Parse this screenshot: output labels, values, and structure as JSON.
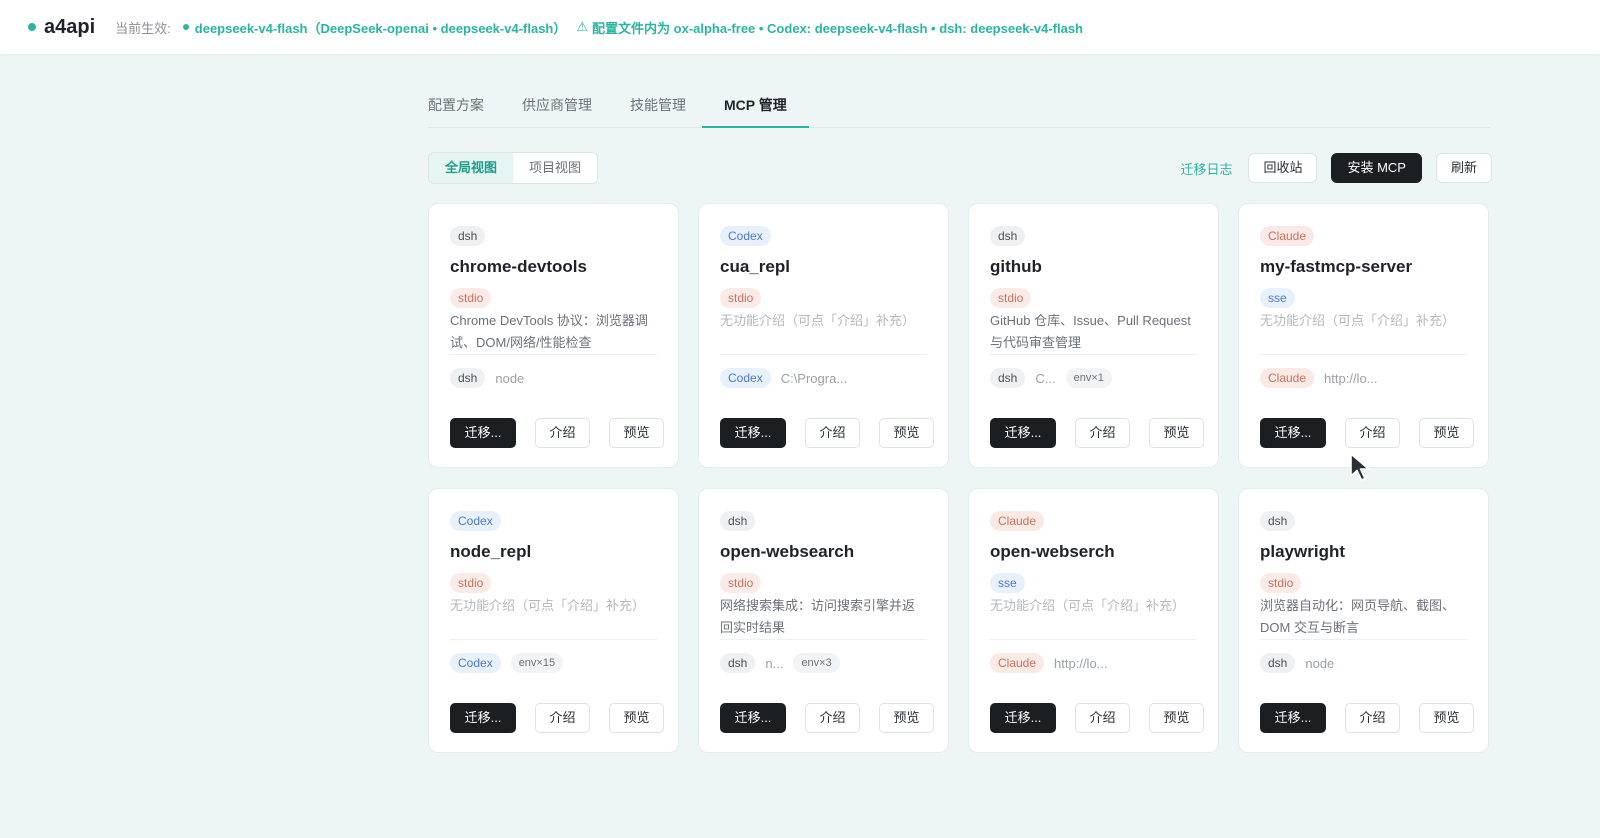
{
  "topbar": {
    "brand": "a4api",
    "current_label": "当前生效:",
    "status_text": "deepseek-v4-flash（DeepSeek-openai • deepseek-v4-flash）",
    "warning_icon": "⚠",
    "warning_text": "配置文件内为 ox-alpha-free • Codex: deepseek-v4-flash • dsh: deepseek-v4-flash"
  },
  "tabs": [
    {
      "label": "配置方案"
    },
    {
      "label": "供应商管理"
    },
    {
      "label": "技能管理"
    },
    {
      "label": "MCP 管理"
    }
  ],
  "view_toggle": {
    "global": "全局视图",
    "project": "项目视图"
  },
  "actions": {
    "migrate_log": "迁移日志",
    "recycle": "回收站",
    "install": "安装 MCP",
    "refresh": "刷新"
  },
  "card_buttons": {
    "migrate": "迁移...",
    "intro": "介绍",
    "preview": "预览"
  },
  "cards": [
    {
      "source": "dsh",
      "name": "chrome-devtools",
      "protocol": "stdio",
      "desc": "Chrome DevTools 协议：浏览器调试、DOM/网络/性能检查",
      "meta_tag": "dsh",
      "meta_text": "node",
      "env": ""
    },
    {
      "source": "Codex",
      "name": "cua_repl",
      "protocol": "stdio",
      "desc": "无功能介绍（可点「介绍」补充）",
      "meta_tag": "Codex",
      "meta_text": "C:\\Progra...",
      "env": ""
    },
    {
      "source": "dsh",
      "name": "github",
      "protocol": "stdio",
      "desc": "GitHub 仓库、Issue、Pull Request 与代码审查管理",
      "meta_tag": "dsh",
      "meta_text": "C...",
      "env": "env×1"
    },
    {
      "source": "Claude",
      "name": "my-fastmcp-server",
      "protocol": "sse",
      "desc": "无功能介绍（可点「介绍」补充）",
      "meta_tag": "Claude",
      "meta_text": "http://lo...",
      "env": ""
    },
    {
      "source": "Codex",
      "name": "node_repl",
      "protocol": "stdio",
      "desc": "无功能介绍（可点「介绍」补充）",
      "meta_tag": "Codex",
      "meta_text": "",
      "env": "env×15"
    },
    {
      "source": "dsh",
      "name": "open-websearch",
      "protocol": "stdio",
      "desc": "网络搜索集成：访问搜索引擎并返回实时结果",
      "meta_tag": "dsh",
      "meta_text": "n...",
      "env": "env×3"
    },
    {
      "source": "Claude",
      "name": "open-webserch",
      "protocol": "sse",
      "desc": "无功能介绍（可点「介绍」补充）",
      "meta_tag": "Claude",
      "meta_text": "http://lo...",
      "env": ""
    },
    {
      "source": "dsh",
      "name": "playwright",
      "protocol": "stdio",
      "desc": "浏览器自动化：网页导航、截图、DOM 交互与断言",
      "meta_tag": "dsh",
      "meta_text": "node",
      "env": ""
    }
  ],
  "colors": {
    "accent": "#2bb5a1",
    "dark_button": "#1c1f22",
    "background": "#eef6f5"
  }
}
